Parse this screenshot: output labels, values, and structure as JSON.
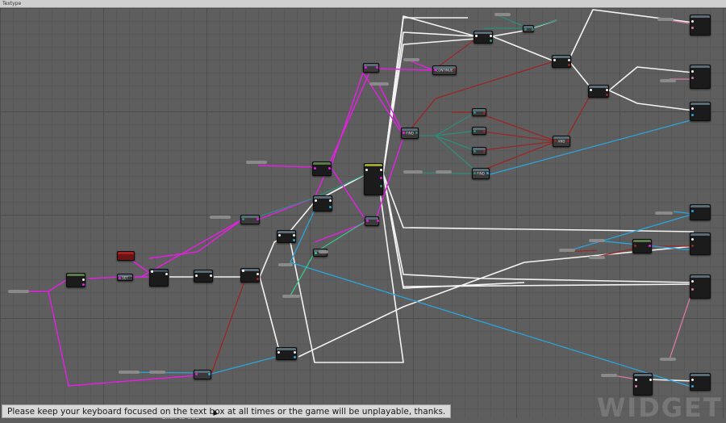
{
  "window": {
    "title": "Textype"
  },
  "graph": {
    "wire_colors": {
      "exec": "#f4f4f4",
      "pink": "#e61ee6",
      "red": "#9b2626",
      "teal": "#2d8c7a",
      "blue": "#2aa5dc",
      "green": "#3cc48a",
      "lightpink": "#d87aa6"
    },
    "node_labels": {
      "continue": "CONTINUE",
      "find1": "FIND",
      "find2": "FIND",
      "and": "AND",
      "set": "SET"
    }
  },
  "toast": {
    "text": "Please keep your keyboard focused on the text box at all times or the game will be unplayable, thanks."
  },
  "hint": {
    "text": "Click to add"
  },
  "watermark": {
    "text": "WIDGET"
  }
}
